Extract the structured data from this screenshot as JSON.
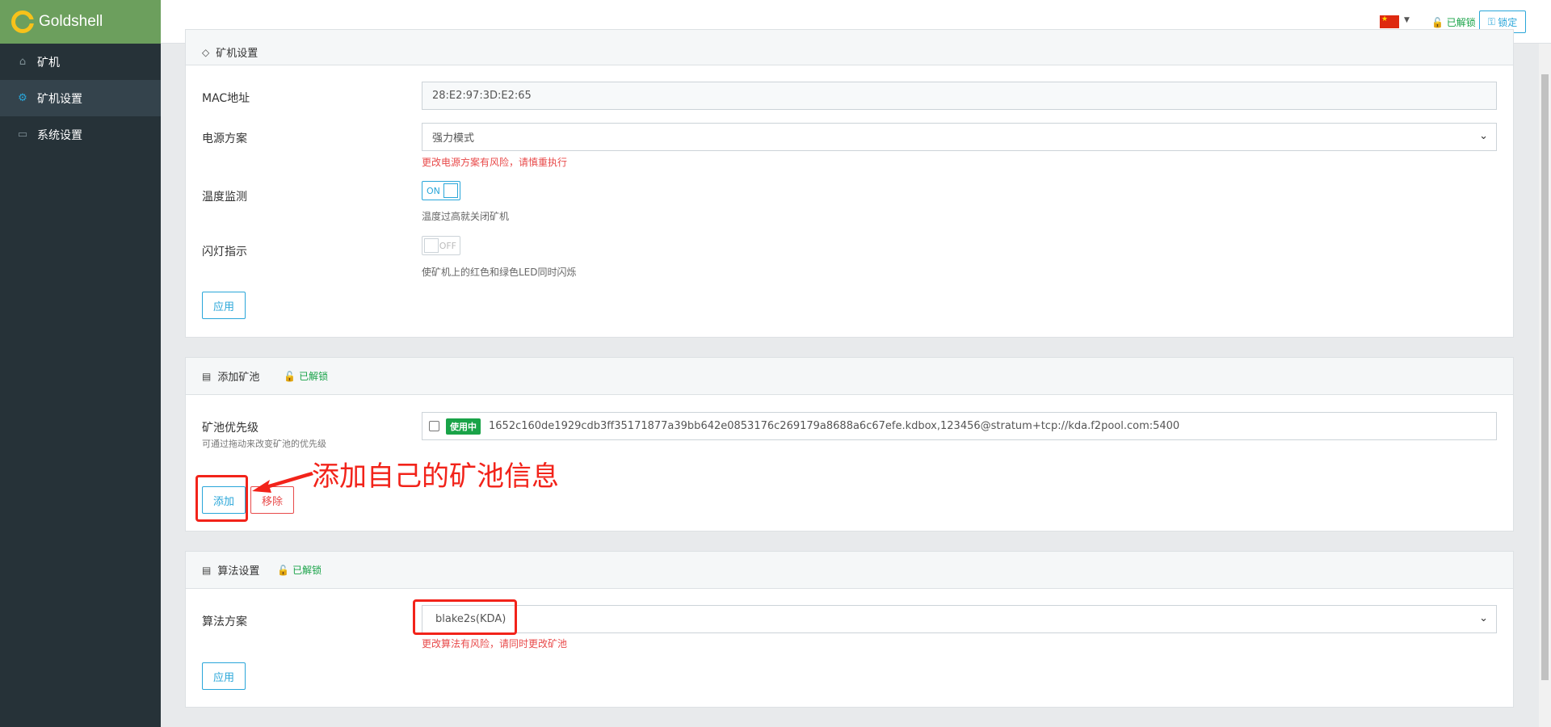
{
  "brand": {
    "name": "Goldshell"
  },
  "sidebar": {
    "items": [
      {
        "label": "矿机",
        "icon": "home-icon",
        "active": false
      },
      {
        "label": "矿机设置",
        "icon": "gear-icon",
        "active": true
      },
      {
        "label": "系统设置",
        "icon": "monitor-icon",
        "active": false
      }
    ]
  },
  "topbar": {
    "flag": "china-flag-icon",
    "lock_status": "已解锁",
    "lock_button": "锁定"
  },
  "miner_settings": {
    "title": "矿机设置",
    "mac": {
      "label": "MAC地址",
      "value": "28:E2:97:3D:E2:65"
    },
    "power": {
      "label": "电源方案",
      "value": "强力模式",
      "warning": "更改电源方案有风险，请慎重执行"
    },
    "temp": {
      "label": "温度监测",
      "state": "ON",
      "hint": "温度过高就关闭矿机"
    },
    "led": {
      "label": "闪灯指示",
      "state": "OFF",
      "hint": "使矿机上的红色和绿色LED同时闪烁"
    },
    "apply": "应用"
  },
  "pools": {
    "title": "添加矿池",
    "lock_status": "已解锁",
    "priority_label": "矿池优先级",
    "priority_hint": "可通过拖动来改变矿池的优先级",
    "items": [
      {
        "status": "使用中",
        "value": "1652c160de1929cdb3ff35171877a39bb642e0853176c269179a8688a6c67efe.kdbox,123456@stratum+tcp://kda.f2pool.com:5400"
      }
    ],
    "add": "添加",
    "remove": "移除"
  },
  "algorithm": {
    "title": "算法设置",
    "lock_status": "已解锁",
    "label": "算法方案",
    "value": "blake2s(KDA)",
    "warning": "更改算法有风险，请同时更改矿池",
    "apply": "应用"
  },
  "annotation": {
    "text": "添加自己的矿池信息",
    "color": "#f2231a"
  },
  "colors": {
    "accent": "#29a6d9",
    "success": "#19a348",
    "danger": "#e84a4a",
    "sidebar": "#263238",
    "brand": "#6c9f5d"
  }
}
